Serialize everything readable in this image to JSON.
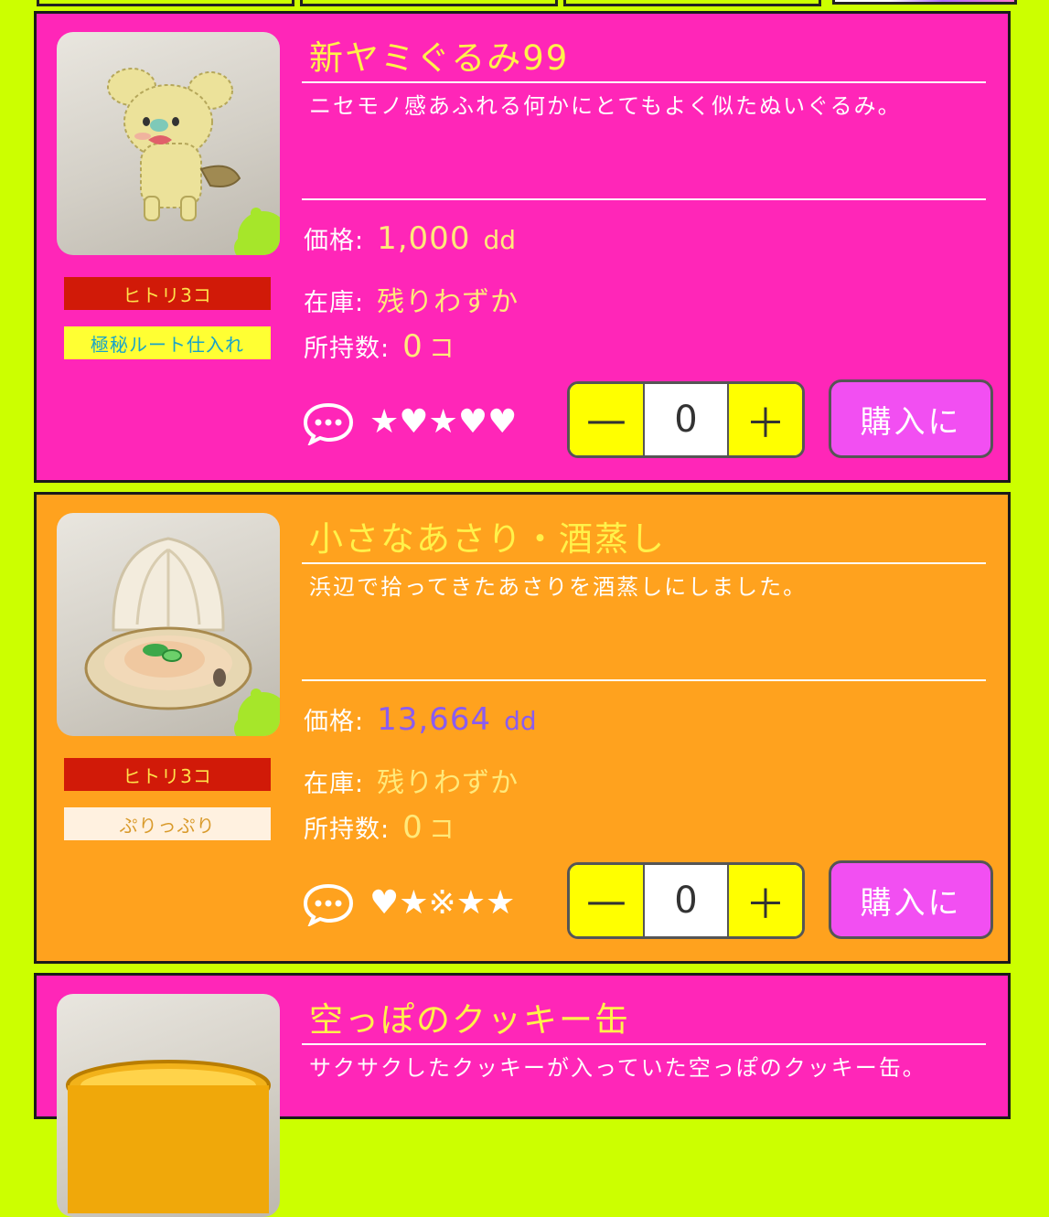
{
  "colors": {
    "page_bg": "#ccff00",
    "card_pink": "#ff26b8",
    "card_orange": "#ffa21e",
    "title_yellow": "#fff24a",
    "buy_button": "#f24ff2",
    "stepper_yellow": "#ffff00",
    "badge_red": "#d11a08"
  },
  "items": [
    {
      "title": "新ヤミぐるみ99",
      "description": "ニセモノ感あふれる何かにとてもよく似たぬいぐるみ。",
      "price_label": "価格:",
      "price_value": "1,000",
      "price_unit": "dd",
      "price_color": "#ffe97a",
      "stock_label": "在庫:",
      "stock_value": "残りわずか",
      "owned_label": "所持数:",
      "owned_value": "0",
      "owned_unit": "コ",
      "rating": "★♥★♥♥",
      "quantity": "0",
      "minus_label": "—",
      "plus_label": "＋",
      "buy_label": "購入に",
      "badge_limit": "ヒトリ3コ",
      "badge_tag": "極秘ルート仕入れ",
      "badge_tag_bg": "#ffff33",
      "badge_tag_color": "#19a3c8",
      "card_color": "#ff26b8",
      "image_icon": "plush-doll-icon"
    },
    {
      "title": "小さなあさり・酒蒸し",
      "description": "浜辺で拾ってきたあさりを酒蒸しにしました。",
      "price_label": "価格:",
      "price_value": "13,664",
      "price_unit": "dd",
      "price_color": "#8a5cf0",
      "stock_label": "在庫:",
      "stock_value": "残りわずか",
      "owned_label": "所持数:",
      "owned_value": "0",
      "owned_unit": "コ",
      "rating": "♥★※★★",
      "quantity": "0",
      "minus_label": "—",
      "plus_label": "＋",
      "buy_label": "購入に",
      "badge_limit": "ヒトリ3コ",
      "badge_tag": "ぷりっぷり",
      "badge_tag_bg": "#fff1e0",
      "badge_tag_color": "#d99a2b",
      "card_color": "#ffa21e",
      "image_icon": "clam-icon"
    },
    {
      "title": "空っぽのクッキー缶",
      "description": "サクサクしたクッキーが入っていた空っぽのクッキー缶。",
      "card_color": "#ff26b8",
      "image_icon": "cookie-tin-icon"
    }
  ]
}
